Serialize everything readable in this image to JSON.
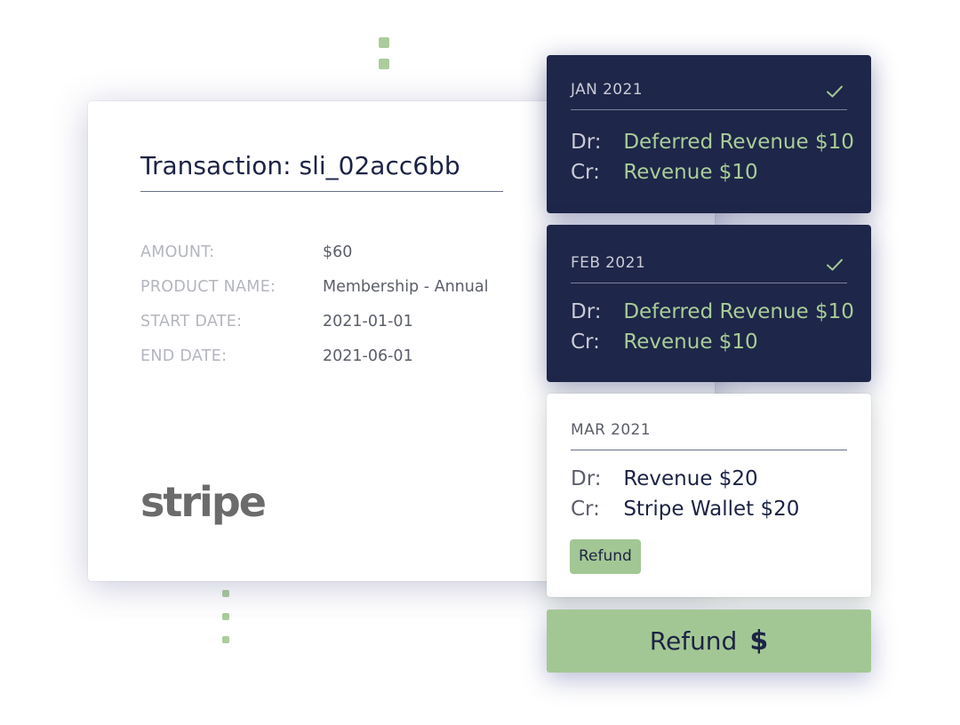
{
  "transaction": {
    "title": "Transaction: sli_02acc6bb",
    "fields": [
      {
        "label": "AMOUNT:",
        "value": "$60"
      },
      {
        "label": "PRODUCT NAME:",
        "value": "Membership - Annual"
      },
      {
        "label": "START DATE:",
        "value": "2021-01-01"
      },
      {
        "label": "END DATE:",
        "value": "2021-06-01"
      }
    ],
    "logo_text": "stripe"
  },
  "periods": [
    {
      "label": "JAN 2021",
      "completed": true,
      "debit_prefix": "Dr:",
      "debit": "Deferred Revenue $10",
      "credit_prefix": "Cr:",
      "credit": "Revenue $10"
    },
    {
      "label": "FEB 2021",
      "completed": true,
      "debit_prefix": "Dr:",
      "debit": "Deferred Revenue $10",
      "credit_prefix": "Cr:",
      "credit": "Revenue $10"
    },
    {
      "label": "MAR 2021",
      "completed": false,
      "debit_prefix": "Dr:",
      "debit": "Revenue $20",
      "credit_prefix": "Cr:",
      "credit": "Stripe Wallet $20",
      "badge": "Refund"
    }
  ],
  "refund_button": {
    "label": "Refund",
    "icon": "dollar-icon",
    "symbol": "$"
  },
  "colors": {
    "navy": "#1e2649",
    "accent_green": "#a3c794",
    "green_text": "#a8cd98",
    "dark_text": "#1c2344"
  }
}
